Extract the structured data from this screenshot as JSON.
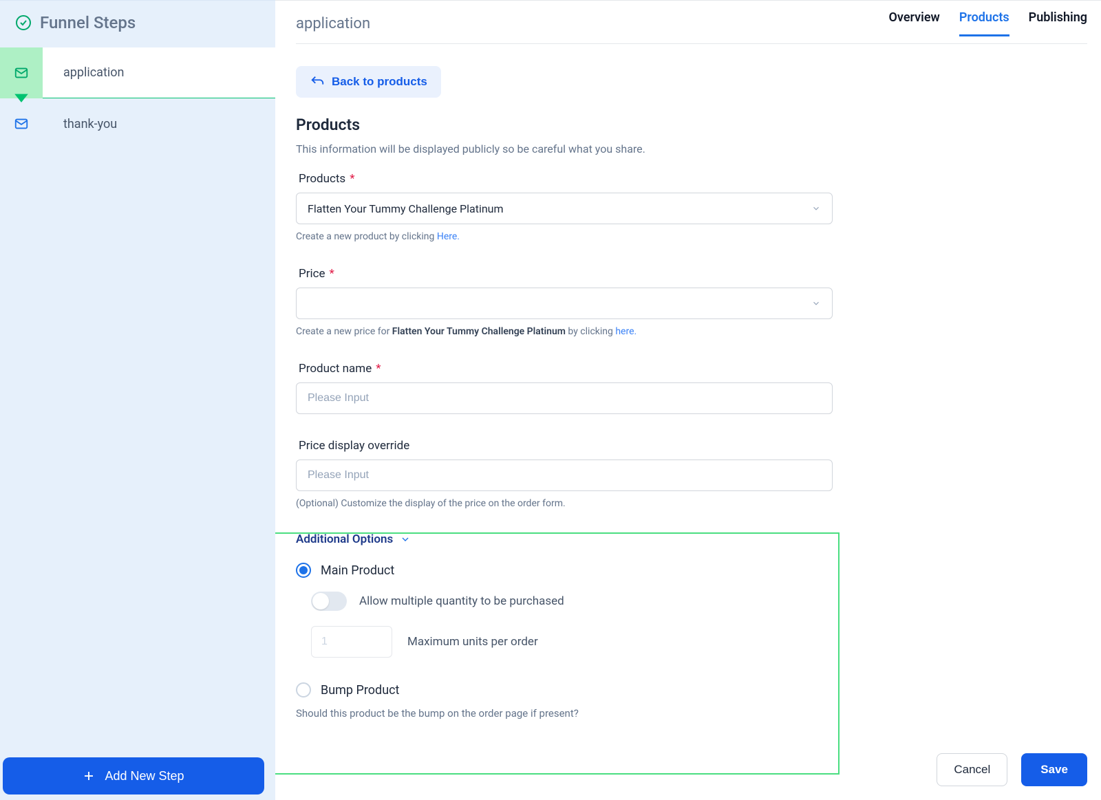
{
  "sidebar": {
    "title": "Funnel Steps",
    "steps": [
      {
        "label": "application",
        "active": true
      },
      {
        "label": "thank-you",
        "active": false
      }
    ],
    "addButton": "Add New Step"
  },
  "header": {
    "pageTitle": "application",
    "tabs": [
      {
        "label": "Overview",
        "active": false
      },
      {
        "label": "Products",
        "active": true
      },
      {
        "label": "Publishing",
        "active": false
      }
    ]
  },
  "backButton": "Back to products",
  "sectionTitle": "Products",
  "sectionDesc": "This information will be displayed publicly so be careful what you share.",
  "productsField": {
    "label": "Products",
    "value": "Flatten Your Tummy Challenge Platinum",
    "helperPrefix": "Create a new product by clicking ",
    "helperLink": "Here."
  },
  "priceField": {
    "label": "Price",
    "value": "",
    "helperPrefix": "Create a new price for ",
    "helperBold": "Flatten Your Tummy Challenge Platinum",
    "helperMid": " by clicking ",
    "helperLink": "here."
  },
  "productNameField": {
    "label": "Product name",
    "placeholder": "Please Input"
  },
  "priceDisplayField": {
    "label": "Price display override",
    "placeholder": "Please Input",
    "helper": "(Optional) Customize the display of the price on the order form."
  },
  "additional": {
    "heading": "Additional Options",
    "mainProduct": "Main Product",
    "allowMultiple": "Allow multiple quantity to be purchased",
    "maxUnitsValue": "1",
    "maxUnitsLabel": "Maximum units per order",
    "bumpProduct": "Bump Product",
    "bumpHelper": "Should this product be the bump on the order page if present?"
  },
  "buttons": {
    "cancel": "Cancel",
    "save": "Save"
  }
}
